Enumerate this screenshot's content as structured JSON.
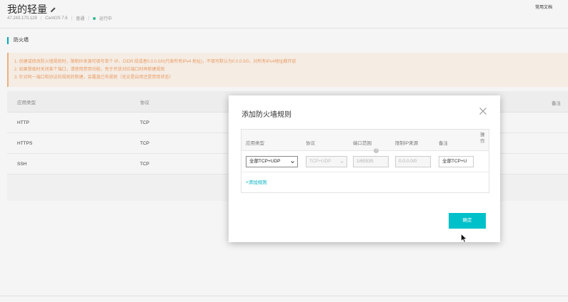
{
  "header": {
    "title": "我的轻量",
    "ip": "47.243.170.129",
    "os": "CentOS 7.6",
    "tier": "普通",
    "status": "运行中",
    "docs_link": "常用文档"
  },
  "section": {
    "title": "防火墙"
  },
  "notice": {
    "lines": [
      "1. 创建或修改防火墙规则时，限制IP来源可填写单个 IP、CIDR 段或者0.0.0.0/0(代表所有IPv4 地址)，不填写默认为0.0.0.0/0，对所有IPv4地址都开放",
      "2. 如果想临时关闭某个端口，请使用禁用功能，免于开放对应端口时再新建规则",
      "3. 针对同一端口和协议的规则的新建，会覆盖已有规则（无论是启用还是禁用状态）"
    ]
  },
  "table": {
    "columns": [
      "应用类型",
      "协议",
      "备注"
    ],
    "rows": [
      {
        "app": "HTTP",
        "proto": "TCP"
      },
      {
        "app": "HTTPS",
        "proto": "TCP"
      },
      {
        "app": "SSH",
        "proto": "TCP"
      }
    ]
  },
  "modal": {
    "title": "添加防火墙规则",
    "columns": {
      "app": "应用类型",
      "proto": "协议",
      "port": "端口范围",
      "ip": "限制IP来源",
      "note": "备注",
      "op": "操作"
    },
    "rule": {
      "app": "全部TCP+UDP",
      "proto": "TCP+UDP",
      "port": "1/65535",
      "ip": "0.0.0.0/0",
      "note": "全部TCP+U"
    },
    "add_rule": "+添加规则",
    "confirm": "确定"
  },
  "colors": {
    "accent": "#00c1c9",
    "notice_text": "#f2a36a",
    "notice_bg": "#fff6ed",
    "status_running": "#3cc29a"
  }
}
